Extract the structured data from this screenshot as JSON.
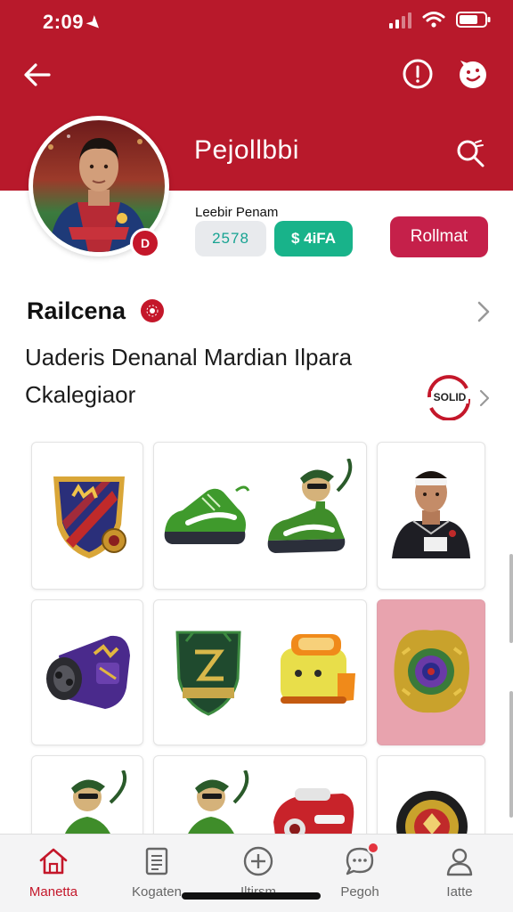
{
  "status_bar": {
    "time": "2:09",
    "location_glyph": "➤"
  },
  "header": {
    "profile_name": "Pejollbbi",
    "avatar_badge": "D"
  },
  "stats": {
    "caption": "Leebir Penam",
    "count": "2578",
    "green_label": "$ 4iFA",
    "action_button": "Rollmat"
  },
  "section": {
    "title": "Railcena",
    "description_line1": "Uaderis Denanal Mardian Ilpara",
    "description_line2": "Ckalegiaor",
    "logo_text": "SOLID"
  },
  "grid_items": [
    {
      "icon": "club-crest-icon"
    },
    {
      "icon": "green-sneaker-icon"
    },
    {
      "icon": "mascot-cleat-icon"
    },
    {
      "icon": "player-portrait-icon"
    },
    {
      "icon": "purple-roll-icon"
    },
    {
      "icon": "green-shield-icon"
    },
    {
      "icon": "yellow-toy-icon"
    },
    {
      "icon": "gold-ring-icon"
    },
    {
      "icon": "mascot-icon"
    },
    {
      "icon": "mascot-icon"
    },
    {
      "icon": "red-machine-icon"
    },
    {
      "icon": "medallion-icon"
    }
  ],
  "bottom_nav": [
    {
      "label": "Manetta",
      "icon": "home-icon",
      "active": true
    },
    {
      "label": "Kogaten",
      "icon": "document-icon",
      "active": false
    },
    {
      "label": "Iltirsm",
      "icon": "add-circle-icon",
      "active": false
    },
    {
      "label": "Pegoh",
      "icon": "chat-bubble-icon",
      "active": false
    },
    {
      "label": "Iatte",
      "icon": "person-icon",
      "active": false
    }
  ],
  "colors": {
    "brand_red": "#b8192b",
    "accent_teal": "#18b38a",
    "button_pink": "#c5204a"
  }
}
